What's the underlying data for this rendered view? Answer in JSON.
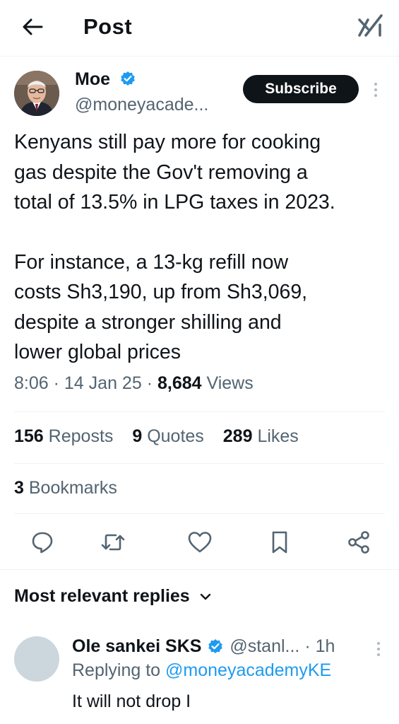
{
  "header": {
    "title": "Post",
    "back_icon": "arrow-left-icon",
    "grok_icon": "grok-icon"
  },
  "post": {
    "author": {
      "name": "Moe",
      "handle": "@moneyacade...",
      "verified": true
    },
    "subscribe_label": "Subscribe",
    "text_lines_1": [
      "Kenyans still pay more for cooking",
      "gas despite the Gov't removing a",
      "total of 13.5% in LPG taxes in 2023."
    ],
    "text_lines_2": [
      "For instance, a 13-kg refill now",
      "costs Sh3,190, up from Sh3,069,",
      "despite a stronger shilling and",
      "lower global prices"
    ],
    "time": "8:06",
    "date": "14 Jan 25",
    "views_count": "8,684",
    "views_label": "Views",
    "stats": {
      "reposts_count": "156",
      "reposts_label": "Reposts",
      "quotes_count": "9",
      "quotes_label": "Quotes",
      "likes_count": "289",
      "likes_label": "Likes",
      "bookmarks_count": "3",
      "bookmarks_label": "Bookmarks"
    }
  },
  "actions": [
    "reply-icon",
    "repost-icon",
    "like-icon",
    "bookmark-icon",
    "share-icon"
  ],
  "replies": {
    "header": "Most relevant replies",
    "items": [
      {
        "name": "Ole sankei SKS",
        "handle": "@stanl...",
        "time": "1h",
        "replying_prefix": "Replying to",
        "replying_to": "@moneyacademyKE",
        "text": "It will not drop I"
      }
    ]
  },
  "colors": {
    "accent": "#1d9bf0",
    "text_primary": "#0f1419",
    "text_secondary": "#536471",
    "divider": "#eff3f4",
    "button_dark": "#0f1419"
  }
}
